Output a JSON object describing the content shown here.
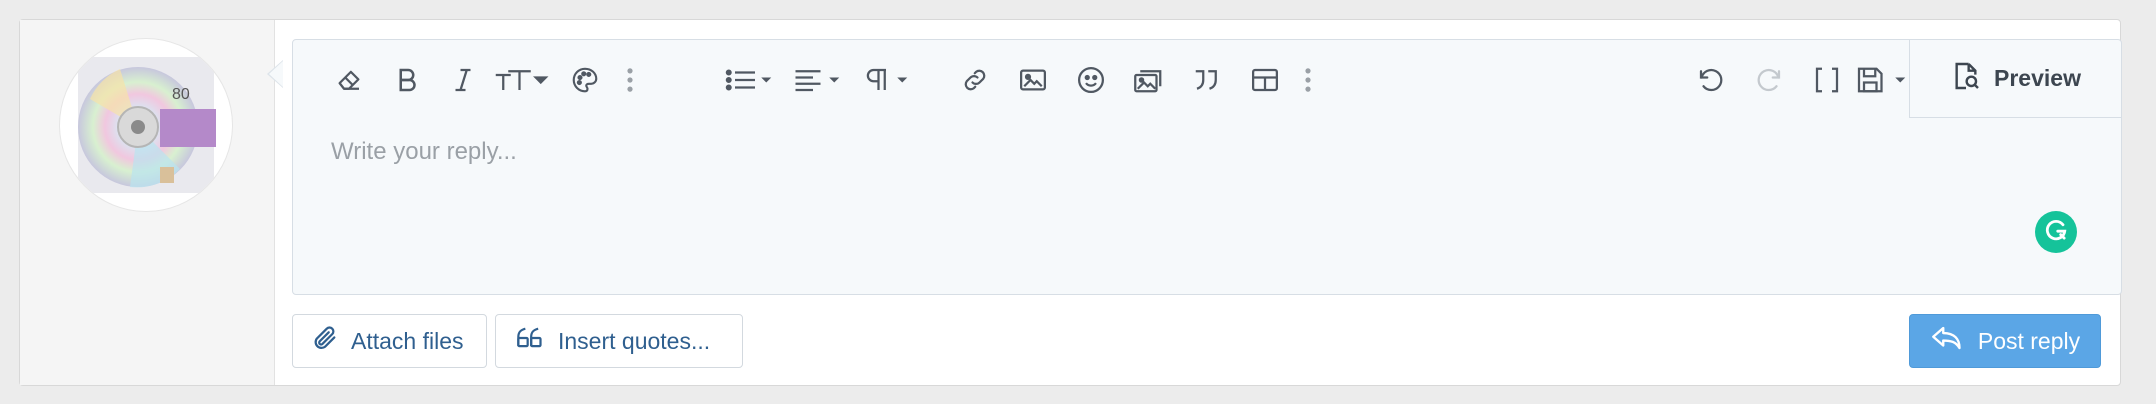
{
  "toolbar": {
    "items": [
      {
        "icon": "eraser-icon",
        "label": "Remove formatting"
      },
      {
        "icon": "bold-icon",
        "label": "Bold"
      },
      {
        "icon": "italic-icon",
        "label": "Italic"
      },
      {
        "icon": "text-size-icon",
        "label": "Font size"
      },
      {
        "icon": "palette-icon",
        "label": "Text color"
      },
      {
        "icon": "more-vertical-icon",
        "label": "More text options"
      },
      {
        "icon": "list-icon",
        "label": "List"
      },
      {
        "icon": "align-left-icon",
        "label": "Alignment"
      },
      {
        "icon": "paragraph-icon",
        "label": "Paragraph format"
      },
      {
        "icon": "link-icon",
        "label": "Insert link"
      },
      {
        "icon": "image-icon",
        "label": "Insert image"
      },
      {
        "icon": "smiley-icon",
        "label": "Smilies"
      },
      {
        "icon": "media-icon",
        "label": "Insert media"
      },
      {
        "icon": "quote-icon",
        "label": "Quote"
      },
      {
        "icon": "table-icon",
        "label": "Insert table"
      },
      {
        "icon": "more-vertical-icon",
        "label": "More insert options"
      },
      {
        "icon": "undo-icon",
        "label": "Undo"
      },
      {
        "icon": "redo-icon",
        "label": "Redo"
      },
      {
        "icon": "toggle-bbcode-icon",
        "label": "Toggle BB code"
      },
      {
        "icon": "save-icon",
        "label": "Drafts"
      }
    ],
    "preview_label": "Preview"
  },
  "editor": {
    "placeholder": "Write your reply...",
    "value": ""
  },
  "actions": {
    "attach_label": "Attach files",
    "insert_quotes_label": "Insert quotes...",
    "post_label": "Post reply"
  },
  "avatar": {
    "badge_text": "80"
  },
  "colors": {
    "primary": "#5ba6e6",
    "link": "#2f5f8f",
    "editor_bg": "#f6f9fb",
    "grammarly": "#15c39a"
  }
}
